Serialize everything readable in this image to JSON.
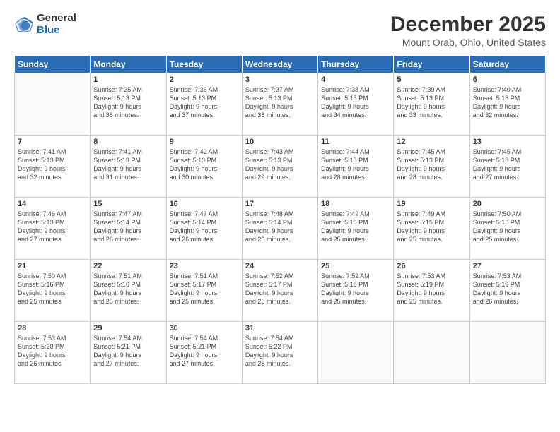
{
  "logo": {
    "general": "General",
    "blue": "Blue"
  },
  "title": "December 2025",
  "subtitle": "Mount Orab, Ohio, United States",
  "headers": [
    "Sunday",
    "Monday",
    "Tuesday",
    "Wednesday",
    "Thursday",
    "Friday",
    "Saturday"
  ],
  "weeks": [
    [
      {
        "day": "",
        "info": ""
      },
      {
        "day": "1",
        "info": "Sunrise: 7:35 AM\nSunset: 5:13 PM\nDaylight: 9 hours\nand 38 minutes."
      },
      {
        "day": "2",
        "info": "Sunrise: 7:36 AM\nSunset: 5:13 PM\nDaylight: 9 hours\nand 37 minutes."
      },
      {
        "day": "3",
        "info": "Sunrise: 7:37 AM\nSunset: 5:13 PM\nDaylight: 9 hours\nand 36 minutes."
      },
      {
        "day": "4",
        "info": "Sunrise: 7:38 AM\nSunset: 5:13 PM\nDaylight: 9 hours\nand 34 minutes."
      },
      {
        "day": "5",
        "info": "Sunrise: 7:39 AM\nSunset: 5:13 PM\nDaylight: 9 hours\nand 33 minutes."
      },
      {
        "day": "6",
        "info": "Sunrise: 7:40 AM\nSunset: 5:13 PM\nDaylight: 9 hours\nand 32 minutes."
      }
    ],
    [
      {
        "day": "7",
        "info": "Sunrise: 7:41 AM\nSunset: 5:13 PM\nDaylight: 9 hours\nand 32 minutes."
      },
      {
        "day": "8",
        "info": "Sunrise: 7:41 AM\nSunset: 5:13 PM\nDaylight: 9 hours\nand 31 minutes."
      },
      {
        "day": "9",
        "info": "Sunrise: 7:42 AM\nSunset: 5:13 PM\nDaylight: 9 hours\nand 30 minutes."
      },
      {
        "day": "10",
        "info": "Sunrise: 7:43 AM\nSunset: 5:13 PM\nDaylight: 9 hours\nand 29 minutes."
      },
      {
        "day": "11",
        "info": "Sunrise: 7:44 AM\nSunset: 5:13 PM\nDaylight: 9 hours\nand 28 minutes."
      },
      {
        "day": "12",
        "info": "Sunrise: 7:45 AM\nSunset: 5:13 PM\nDaylight: 9 hours\nand 28 minutes."
      },
      {
        "day": "13",
        "info": "Sunrise: 7:45 AM\nSunset: 5:13 PM\nDaylight: 9 hours\nand 27 minutes."
      }
    ],
    [
      {
        "day": "14",
        "info": "Sunrise: 7:46 AM\nSunset: 5:13 PM\nDaylight: 9 hours\nand 27 minutes."
      },
      {
        "day": "15",
        "info": "Sunrise: 7:47 AM\nSunset: 5:14 PM\nDaylight: 9 hours\nand 26 minutes."
      },
      {
        "day": "16",
        "info": "Sunrise: 7:47 AM\nSunset: 5:14 PM\nDaylight: 9 hours\nand 26 minutes."
      },
      {
        "day": "17",
        "info": "Sunrise: 7:48 AM\nSunset: 5:14 PM\nDaylight: 9 hours\nand 26 minutes."
      },
      {
        "day": "18",
        "info": "Sunrise: 7:49 AM\nSunset: 5:15 PM\nDaylight: 9 hours\nand 25 minutes."
      },
      {
        "day": "19",
        "info": "Sunrise: 7:49 AM\nSunset: 5:15 PM\nDaylight: 9 hours\nand 25 minutes."
      },
      {
        "day": "20",
        "info": "Sunrise: 7:50 AM\nSunset: 5:15 PM\nDaylight: 9 hours\nand 25 minutes."
      }
    ],
    [
      {
        "day": "21",
        "info": "Sunrise: 7:50 AM\nSunset: 5:16 PM\nDaylight: 9 hours\nand 25 minutes."
      },
      {
        "day": "22",
        "info": "Sunrise: 7:51 AM\nSunset: 5:16 PM\nDaylight: 9 hours\nand 25 minutes."
      },
      {
        "day": "23",
        "info": "Sunrise: 7:51 AM\nSunset: 5:17 PM\nDaylight: 9 hours\nand 25 minutes."
      },
      {
        "day": "24",
        "info": "Sunrise: 7:52 AM\nSunset: 5:17 PM\nDaylight: 9 hours\nand 25 minutes."
      },
      {
        "day": "25",
        "info": "Sunrise: 7:52 AM\nSunset: 5:18 PM\nDaylight: 9 hours\nand 25 minutes."
      },
      {
        "day": "26",
        "info": "Sunrise: 7:53 AM\nSunset: 5:19 PM\nDaylight: 9 hours\nand 25 minutes."
      },
      {
        "day": "27",
        "info": "Sunrise: 7:53 AM\nSunset: 5:19 PM\nDaylight: 9 hours\nand 26 minutes."
      }
    ],
    [
      {
        "day": "28",
        "info": "Sunrise: 7:53 AM\nSunset: 5:20 PM\nDaylight: 9 hours\nand 26 minutes."
      },
      {
        "day": "29",
        "info": "Sunrise: 7:54 AM\nSunset: 5:21 PM\nDaylight: 9 hours\nand 27 minutes."
      },
      {
        "day": "30",
        "info": "Sunrise: 7:54 AM\nSunset: 5:21 PM\nDaylight: 9 hours\nand 27 minutes."
      },
      {
        "day": "31",
        "info": "Sunrise: 7:54 AM\nSunset: 5:22 PM\nDaylight: 9 hours\nand 28 minutes."
      },
      {
        "day": "",
        "info": ""
      },
      {
        "day": "",
        "info": ""
      },
      {
        "day": "",
        "info": ""
      }
    ]
  ]
}
